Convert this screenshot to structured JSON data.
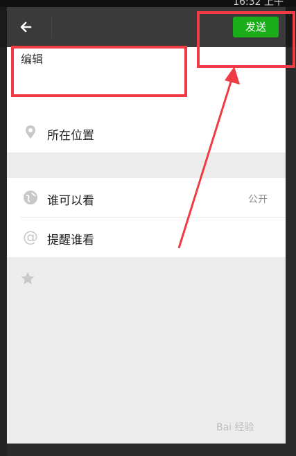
{
  "status": {
    "time": "16:32 上午"
  },
  "header": {
    "send_label": "发送"
  },
  "editor": {
    "text": "编辑"
  },
  "rows": [
    {
      "label": "所在位置",
      "value": ""
    },
    {
      "label": "谁可以看",
      "value": "公开"
    },
    {
      "label": "提醒谁看",
      "value": ""
    }
  ],
  "watermark": {
    "text": "Bai 经验"
  },
  "colors": {
    "send": "#1aad19",
    "annotation": "#ef3b43",
    "header": "#3a3a3a"
  }
}
